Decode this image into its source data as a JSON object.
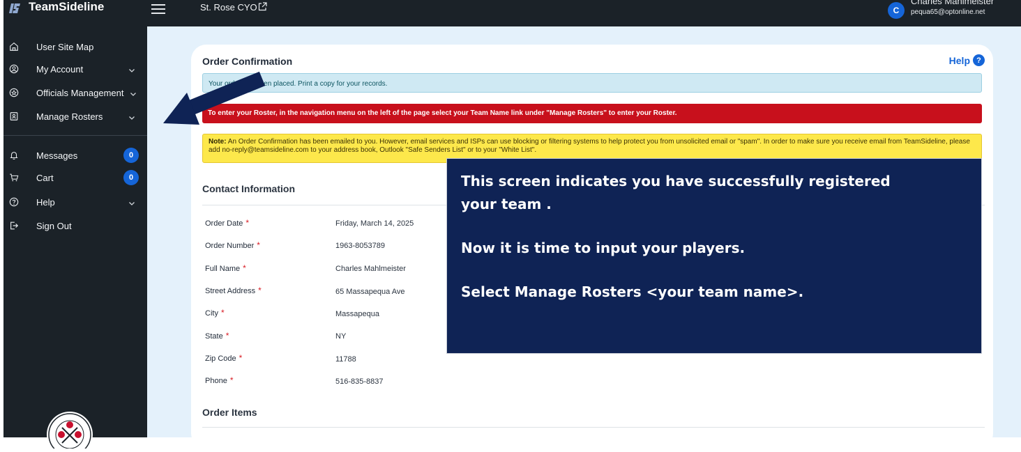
{
  "app": {
    "brand": "TeamSideline",
    "org_name": "St. Rose CYO"
  },
  "user": {
    "initial": "C",
    "name": "Charles Mahlmeister",
    "email": "pequa65@optonline.net"
  },
  "sidebar": {
    "items": [
      {
        "label": "User Site Map",
        "icon": "home-icon"
      },
      {
        "label": "My Account",
        "icon": "user-circle-icon",
        "expandable": true
      },
      {
        "label": "Officials Management",
        "icon": "star-badge-icon",
        "expandable": true
      },
      {
        "label": "Manage Rosters",
        "icon": "id-card-icon",
        "expandable": true
      },
      {
        "label": "Messages",
        "icon": "bell-icon",
        "badge": "0"
      },
      {
        "label": "Cart",
        "icon": "cart-icon",
        "badge": "0"
      },
      {
        "label": "Help",
        "icon": "question-circle-icon",
        "expandable": true
      },
      {
        "label": "Sign Out",
        "icon": "sign-out-icon"
      }
    ]
  },
  "order": {
    "title": "Order Confirmation",
    "help_label": "Help",
    "help_icon": "?",
    "info_alert": "Your order has been placed. Print a copy for your records.",
    "danger_alert": "To enter your Roster, in the navigation menu on the left of the page select your Team Name link under \"Manage Rosters\" to enter your Roster.",
    "warning_note_label": "Note:",
    "warning_note_text": "An Order Confirmation has been emailed to you. However, email services and ISPs can use blocking or filtering systems to help protect you from unsolicited email or \"spam\". In order to make sure you receive email from TeamSideline, please add no-reply@teamsideline.com to your address book, Outlook \"Safe Senders List\" or to your \"White List\".",
    "contact_title": "Contact Information",
    "required_mark": "*",
    "fields": [
      {
        "label": "Order Date",
        "value": "Friday, March 14, 2025"
      },
      {
        "label": "Order Number",
        "value": "1963-8053789"
      },
      {
        "label": "Full Name",
        "value": "Charles Mahlmeister"
      },
      {
        "label": "Street Address",
        "value": "65 Massapequa Ave"
      },
      {
        "label": "City",
        "value": "Massapequa"
      },
      {
        "label": "State",
        "value": "NY"
      },
      {
        "label": "Zip Code",
        "value": "11788"
      },
      {
        "label": "Phone",
        "value": "516-835-8837"
      }
    ],
    "items_title": "Order Items"
  },
  "callout": {
    "line1": "This screen indicates you have successfully registered",
    "line2": "your team .",
    "line3": "Now it is time to input your players.",
    "line4": "Select Manage Rosters <your team name>."
  },
  "colors": {
    "sidebar_bg": "#1b2228",
    "accent_blue": "#1565d8",
    "callout_bg": "#0f2355",
    "danger_red": "#c8101c",
    "warning_yellow": "#fde84b",
    "info_blue": "#cfe9f3",
    "page_bg": "#e4f1fb"
  }
}
